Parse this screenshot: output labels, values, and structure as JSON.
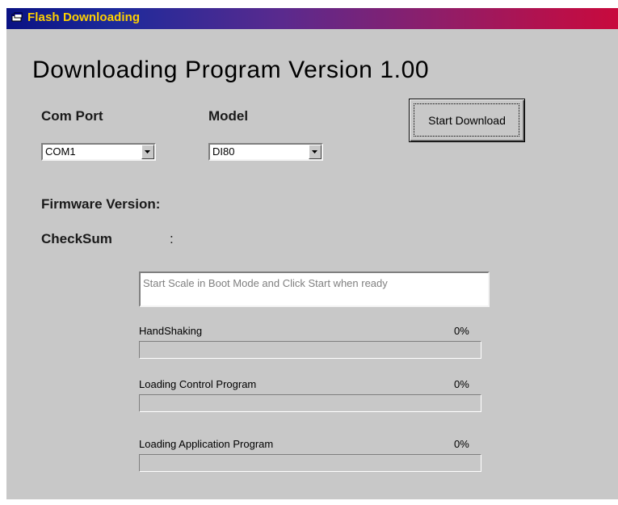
{
  "window": {
    "title": "Flash Downloading",
    "title_icon": "app-window-icon"
  },
  "heading": "Downloading Program Version 1.00",
  "com_port": {
    "label": "Com Port",
    "value": "COM1"
  },
  "model": {
    "label": "Model",
    "value": "DI80"
  },
  "start_button": {
    "label": "Start Download"
  },
  "firmware": {
    "label": "Firmware Version:"
  },
  "checksum": {
    "label": "CheckSum",
    "separator": ":"
  },
  "status_message": "Start Scale in Boot Mode  and Click Start when ready",
  "progress": [
    {
      "label": "HandShaking",
      "percent_text": "0%",
      "value": 0
    },
    {
      "label": "Loading Control Program",
      "percent_text": "0%",
      "value": 0
    },
    {
      "label": "Loading Application Program",
      "percent_text": "0%",
      "value": 0
    }
  ],
  "colors": {
    "window_bg": "#c8c8c8",
    "title_gradient_start": "#0a1283",
    "title_gradient_end": "#c80a3d",
    "title_text": "#ffd100",
    "status_text": "#808080"
  }
}
